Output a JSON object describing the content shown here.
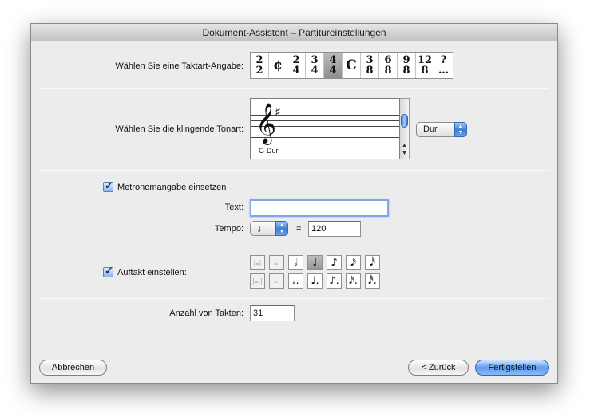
{
  "window": {
    "title": "Dokument-Assistent – Partitureinstellungen"
  },
  "time_signature": {
    "label": "Wählen Sie eine Taktart-Angabe:",
    "options": [
      {
        "top": "2",
        "bottom": "2"
      },
      {
        "single": "¢"
      },
      {
        "top": "2",
        "bottom": "4"
      },
      {
        "top": "3",
        "bottom": "4"
      },
      {
        "top": "4",
        "bottom": "4",
        "selected": true
      },
      {
        "single": "C"
      },
      {
        "top": "3",
        "bottom": "8"
      },
      {
        "top": "6",
        "bottom": "8"
      },
      {
        "top": "9",
        "bottom": "8"
      },
      {
        "top": "12",
        "bottom": "8"
      },
      {
        "top": "?",
        "bottom": "…"
      }
    ]
  },
  "key": {
    "label": "Wählen Sie die klingende Tonart:",
    "clef_glyph": "𝄞",
    "accidental": "♯",
    "key_name": "G-Dur",
    "mode_value": "Dur"
  },
  "metronome": {
    "checkbox_label": "Metronomangabe einsetzen",
    "checked": true,
    "text_label": "Text:",
    "text_value": "",
    "tempo_label": "Tempo:",
    "tempo_note": "♩",
    "equals": "=",
    "tempo_value": "120"
  },
  "pickup": {
    "checkbox_label": "Auftakt einstellen:",
    "checked": true,
    "row1": [
      "|𝅜|",
      "𝅝",
      "𝅗𝅥",
      "♩",
      "♪",
      "𝅘𝅥𝅯",
      "𝅘𝅥𝅰"
    ],
    "row2": [
      "|𝅜.|",
      "𝅝.",
      "𝅗𝅥.",
      "♩.",
      "♪.",
      "𝅘𝅥𝅯.",
      "𝅘𝅥𝅰."
    ],
    "selected_row1_index": 3
  },
  "measures": {
    "label": "Anzahl von Takten:",
    "value": "31"
  },
  "buttons": {
    "cancel": "Abbrechen",
    "back": "< Zurück",
    "finish": "Fertigstellen"
  }
}
